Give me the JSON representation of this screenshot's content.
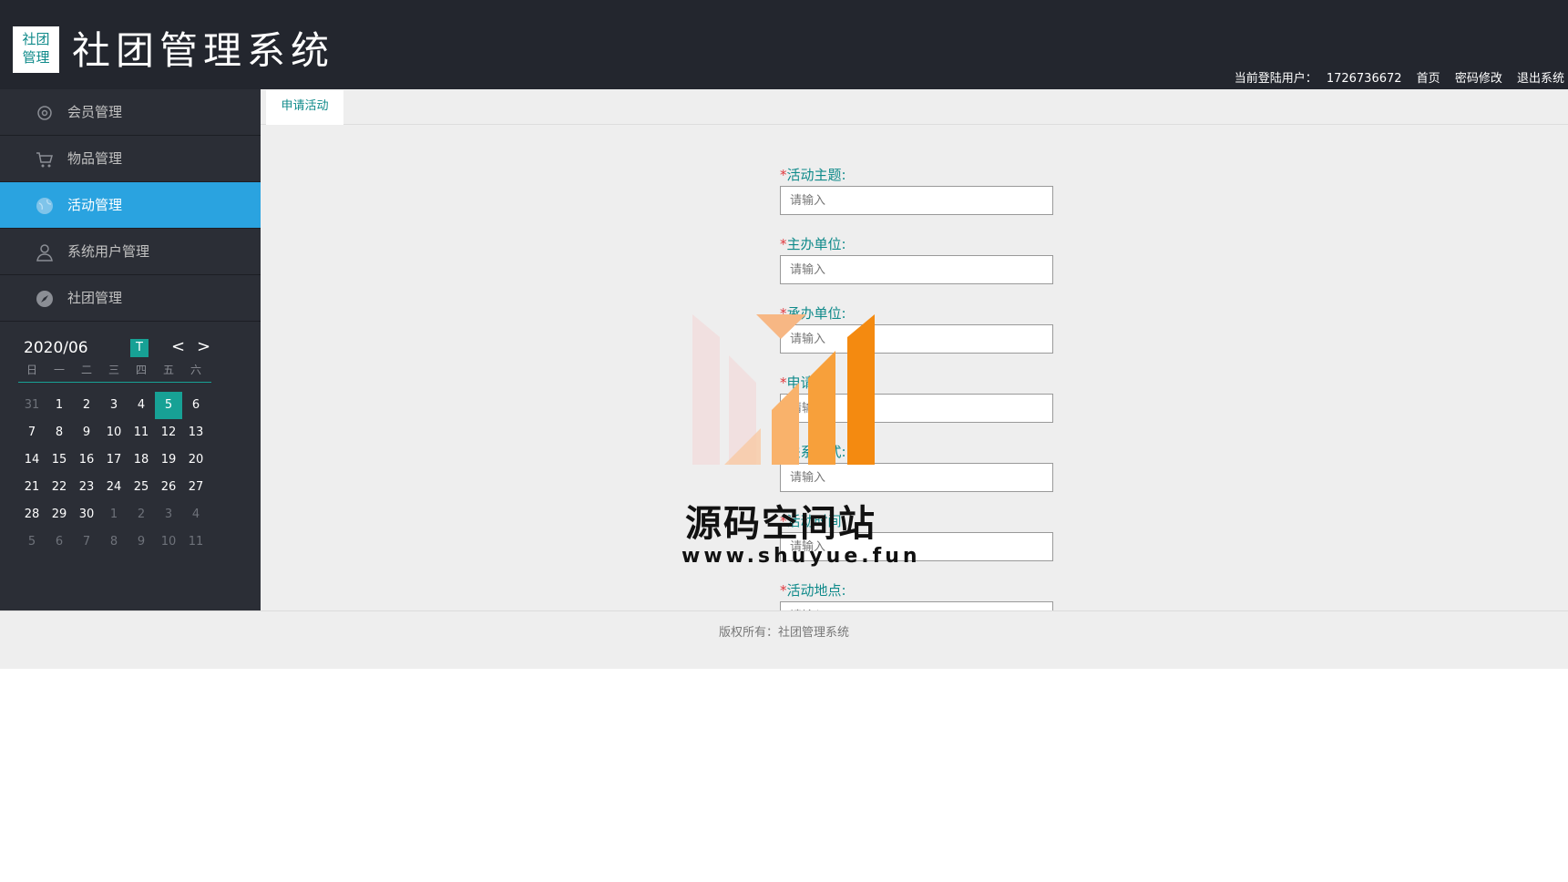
{
  "header": {
    "logo_line1": "社团",
    "logo_line2": "管理",
    "title": "社团管理系统",
    "user_label": "当前登陆用户：",
    "username": "1726736672",
    "links": [
      "首页",
      "密码修改",
      "退出系统"
    ]
  },
  "sidebar": {
    "items": [
      {
        "label": "会员管理",
        "icon": "gear-icon"
      },
      {
        "label": "物品管理",
        "icon": "cart-icon"
      },
      {
        "label": "活动管理",
        "icon": "globe-icon",
        "active": true
      },
      {
        "label": "系统用户管理",
        "icon": "user-icon"
      },
      {
        "label": "社团管理",
        "icon": "compass-icon"
      }
    ]
  },
  "calendar": {
    "month": "2020/06",
    "today_label": "T",
    "prev": "<",
    "next": ">",
    "weekdays": [
      "日",
      "一",
      "二",
      "三",
      "四",
      "五",
      "六"
    ],
    "days": [
      "31",
      "1",
      "2",
      "3",
      "4",
      "5",
      "6",
      "7",
      "8",
      "9",
      "10",
      "11",
      "12",
      "13",
      "14",
      "15",
      "16",
      "17",
      "18",
      "19",
      "20",
      "21",
      "22",
      "23",
      "24",
      "25",
      "26",
      "27",
      "28",
      "29",
      "30",
      "1",
      "2",
      "3",
      "4",
      "5",
      "6",
      "7",
      "8",
      "9",
      "10",
      "11"
    ],
    "selected": "5"
  },
  "tabs": [
    {
      "label": "申请活动"
    }
  ],
  "form": {
    "fields": [
      {
        "label": "活动主题:",
        "placeholder": "请输入"
      },
      {
        "label": "主办单位:",
        "placeholder": "请输入"
      },
      {
        "label": "承办单位:",
        "placeholder": "请输入"
      },
      {
        "label": "申请人:",
        "placeholder": "请输入"
      },
      {
        "label": "联系方式:",
        "placeholder": "请输入"
      },
      {
        "label": "活动时间:",
        "placeholder": "请输入"
      },
      {
        "label": "活动地点:",
        "placeholder": "请输入"
      }
    ]
  },
  "footer": {
    "text": "版权所有：社团管理系统"
  },
  "watermark": {
    "title": "源码空间站",
    "url": "www.shuyue.fun"
  },
  "colors": {
    "header_bg": "#23262e",
    "sidebar_bg": "#2b2e36",
    "active_nav": "#2aa3e0",
    "accent": "#17a195",
    "label": "#0f8a8a",
    "required": "#e0393e"
  }
}
